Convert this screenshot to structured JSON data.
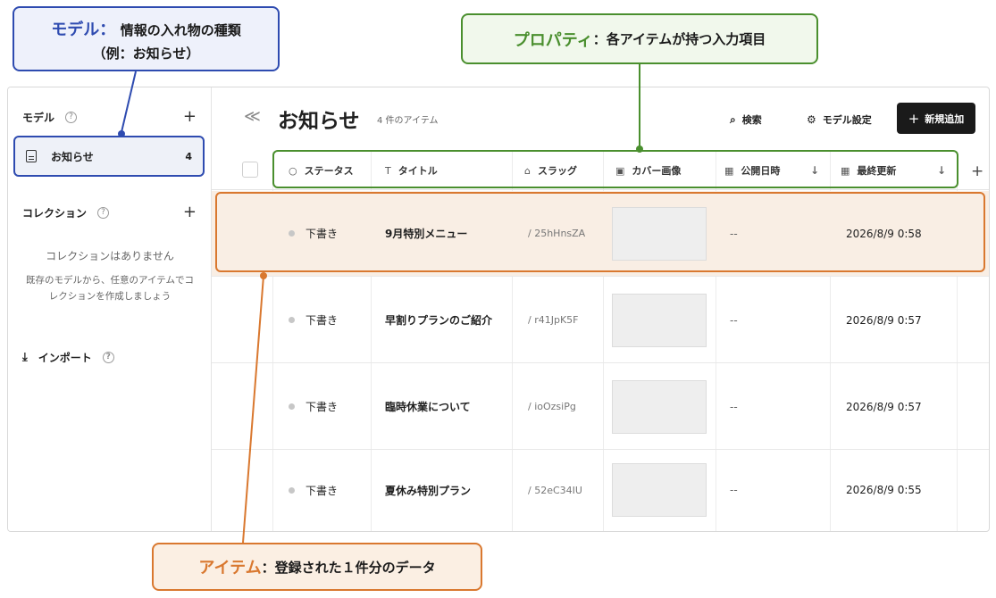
{
  "annotations": {
    "model": {
      "key": "モデル",
      "sep": "：",
      "text": "情報の入れ物の種類",
      "sub": "（例：お知らせ）"
    },
    "property": {
      "key": "プロパティ",
      "sep": "：",
      "text": "各アイテムが持つ入力項目"
    },
    "item": {
      "key": "アイテム",
      "sep": "：",
      "text": "登録された１件分のデータ"
    }
  },
  "sidebar": {
    "models_label": "モデル",
    "help": "?",
    "add": "+",
    "model_items": [
      {
        "name": "お知らせ",
        "count": "4",
        "icon": "document-icon"
      }
    ],
    "collections_label": "コレクション",
    "collections_empty_title": "コレクションはありません",
    "collections_empty_desc": "既存のモデルから、任意のアイテムでコレクションを作成しましょう",
    "import_label": "インポート",
    "import_icon": "download-icon"
  },
  "header": {
    "collapse": "≪",
    "title": "お知らせ",
    "item_count": "4 件のアイテム",
    "search_label": "検索",
    "model_settings_label": "モデル設定",
    "add_button_label": "新規追加",
    "add_button_icon": "+"
  },
  "table": {
    "columns": [
      {
        "key": "status",
        "label": "ステータス",
        "icon": "○"
      },
      {
        "key": "title",
        "label": "タイトル",
        "icon": "T"
      },
      {
        "key": "slug",
        "label": "スラッグ",
        "icon": "tag-icon"
      },
      {
        "key": "cover",
        "label": "カバー画像",
        "icon": "image-icon"
      },
      {
        "key": "published",
        "label": "公開日時",
        "icon": "calendar-icon",
        "sortable": true
      },
      {
        "key": "updated",
        "label": "最終更新",
        "icon": "calendar-icon",
        "sortable": true
      }
    ],
    "add_column": "+",
    "rows": [
      {
        "status": "下書き",
        "title": "9月特別メニュー",
        "slug": "/ 25hHnsZA",
        "published": "--",
        "updated": "2026/8/9 0:58",
        "selected": true
      },
      {
        "status": "下書き",
        "title": "早割りプランのご紹介",
        "slug": "/ r41JpK5F",
        "published": "--",
        "updated": "2026/8/9 0:57"
      },
      {
        "status": "下書き",
        "title": "臨時休業について",
        "slug": "/ ioOzsiPg",
        "published": "--",
        "updated": "2026/8/9 0:57"
      },
      {
        "status": "下書き",
        "title": "夏休み特別プラン",
        "slug": "/ 52eC34IU",
        "published": "--",
        "updated": "2026/8/9 0:55"
      }
    ]
  },
  "colors": {
    "model": "#2e4bb0",
    "property": "#4a8f2e",
    "item": "#d9782f",
    "primary_button": "#1a1a1a"
  }
}
